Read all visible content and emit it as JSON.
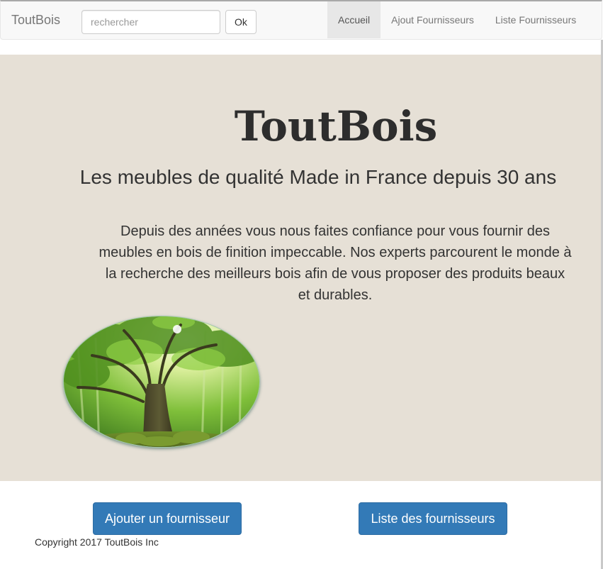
{
  "navbar": {
    "brand": "ToutBois",
    "search": {
      "placeholder": "rechercher",
      "value": ""
    },
    "ok_label": "Ok",
    "links": [
      {
        "label": "Accueil",
        "active": true
      },
      {
        "label": "Ajout Fournisseurs",
        "active": false
      },
      {
        "label": "Liste Fournisseurs",
        "active": false
      }
    ]
  },
  "hero": {
    "title": "ToutBois",
    "subtitle": "Les meubles de qualité Made in France depuis 30 ans",
    "text": "Depuis des années vous nous faites confiance pour vous fournir des meubles en bois de finition impeccable. Nos experts parcourent le monde à la recherche des meilleurs bois afin de vous proposer des produits beaux et durables.",
    "background_color": "#e6e0d6"
  },
  "actions": {
    "add_label": "Ajouter un fournisseur",
    "list_label": "Liste des fournisseurs",
    "button_color": "#337ab7"
  },
  "footer": {
    "copyright": "Copyright 2017 ToutBois Inc"
  }
}
